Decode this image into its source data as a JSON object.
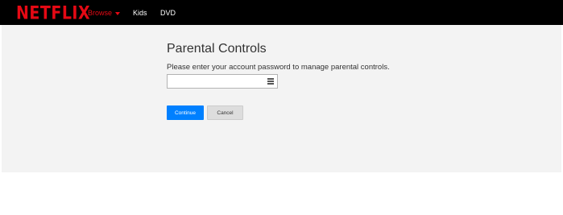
{
  "header": {
    "logo_text": "NETFLIX",
    "nav": [
      {
        "label": "Browse",
        "active": true
      },
      {
        "label": "Kids"
      },
      {
        "label": "DVD"
      }
    ],
    "brand_color": "#e50914"
  },
  "main": {
    "title": "Parental Controls",
    "instruction": "Please enter your account password to manage parental controls.",
    "password_field": {
      "value": "",
      "placeholder": "",
      "icon": "password-manager-icon"
    },
    "continue_label": "Continue",
    "cancel_label": "Cancel",
    "accent_color": "#0080ff"
  }
}
